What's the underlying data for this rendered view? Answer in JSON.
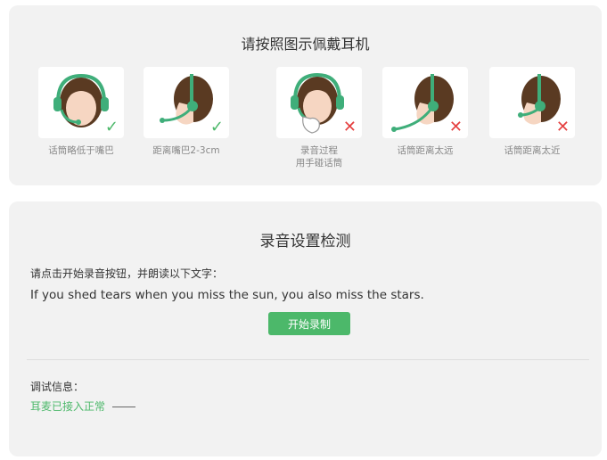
{
  "wear_guide": {
    "title": "请按照图示佩戴耳机",
    "cards": [
      {
        "caption": "话筒略低于嘴巴",
        "icon": "headset-front-icon",
        "mark": "✓",
        "status": "correct"
      },
      {
        "caption": "距离嘴巴2-3cm",
        "icon": "headset-side-icon",
        "mark": "✓",
        "status": "correct"
      },
      {
        "caption": "录音过程\n用手碰话筒",
        "icon": "headset-hand-icon",
        "mark": "✕",
        "status": "wrong"
      },
      {
        "caption": "话筒距离太远",
        "icon": "headset-side-far-icon",
        "mark": "✕",
        "status": "wrong"
      },
      {
        "caption": "话筒距离太近",
        "icon": "headset-side-near-icon",
        "mark": "✕",
        "status": "wrong"
      }
    ]
  },
  "recording_check": {
    "title": "录音设置检测",
    "instruction": "请点击开始录音按钮，并朗读以下文字：",
    "sentence": "If you shed tears when you miss the sun, you also miss the stars.",
    "start_button": "开始录制",
    "debug_label": "调试信息：",
    "debug_status": "耳麦已接入正常"
  },
  "colors": {
    "accent_green": "#4cb86a",
    "error_red": "#e54040",
    "panel_bg": "#f2f2f2"
  }
}
